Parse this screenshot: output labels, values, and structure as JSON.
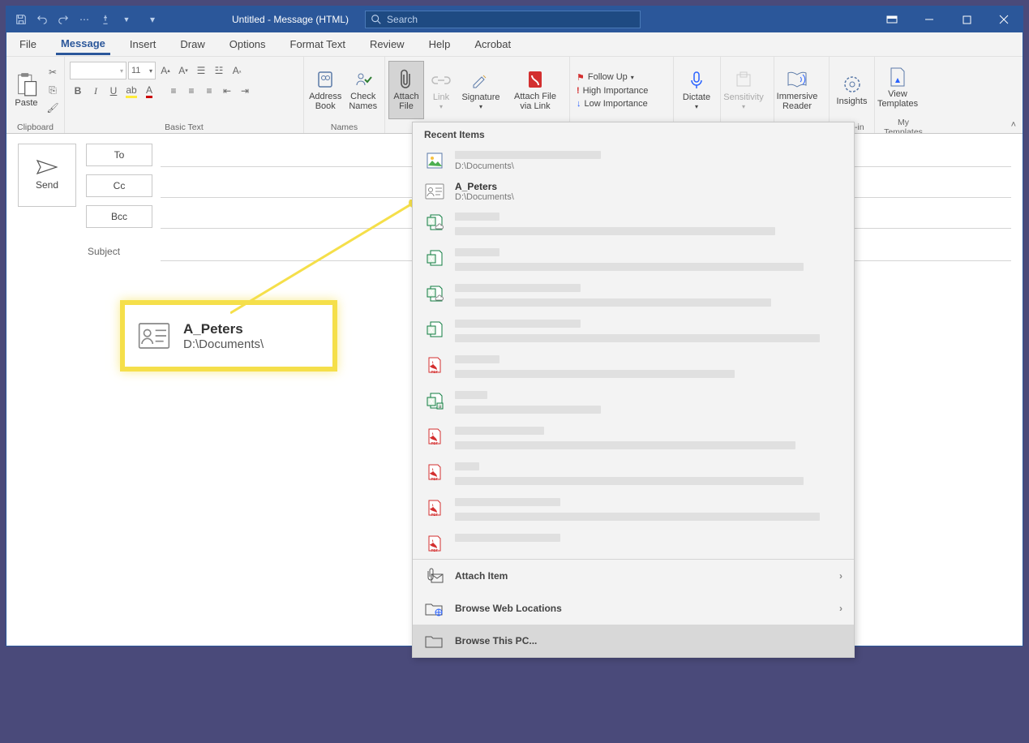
{
  "title": "Untitled  -  Message (HTML)",
  "search": {
    "placeholder": "Search"
  },
  "tabs": [
    "File",
    "Message",
    "Insert",
    "Draw",
    "Options",
    "Format Text",
    "Review",
    "Help",
    "Acrobat"
  ],
  "activeTab": "Message",
  "ribbon": {
    "clipboard": {
      "paste": "Paste",
      "label": "Clipboard"
    },
    "basictext": {
      "label": "Basic Text",
      "fontsize": "11"
    },
    "names": {
      "address": "Address\nBook",
      "check": "Check\nNames",
      "label": "Names"
    },
    "include": {
      "attach": "Attach\nFile",
      "link": "Link",
      "sig": "Signature",
      "via": "Attach File\nvia Link"
    },
    "tags": {
      "follow": "Follow Up",
      "high": "High Importance",
      "low": "Low Importance"
    },
    "dictate": "Dictate",
    "sensitivity": "Sensitivity",
    "immersive": "Immersive\nReader",
    "insights": "Insights",
    "view": "View\nTemplates",
    "addin": "Add-in",
    "mytpl": "My Templates"
  },
  "compose": {
    "send": "Send",
    "to": "To",
    "cc": "Cc",
    "bcc": "Bcc",
    "subject": "Subject"
  },
  "dropdown": {
    "header": "Recent Items",
    "items": [
      {
        "type": "image",
        "name": "",
        "path": "D:\\Documents\\",
        "redactName": true,
        "nameW": 180
      },
      {
        "type": "vcard",
        "name": "A_Peters",
        "path": "D:\\Documents\\"
      },
      {
        "type": "excel-cloud",
        "redactName": true,
        "nameW": 55,
        "pathW": 395
      },
      {
        "type": "excel",
        "redactName": true,
        "nameW": 55,
        "pathW": 430
      },
      {
        "type": "excel-cloud",
        "redactName": true,
        "nameW": 155,
        "pathW": 390
      },
      {
        "type": "excel",
        "redactName": true,
        "nameW": 155,
        "pathW": 450
      },
      {
        "type": "pdf",
        "redactName": true,
        "nameW": 55,
        "pathW": 345
      },
      {
        "type": "excel-a",
        "redactName": true,
        "nameW": 40,
        "pathW": 180
      },
      {
        "type": "pdf",
        "redactName": true,
        "nameW": 110,
        "pathW": 420
      },
      {
        "type": "pdf",
        "redactName": true,
        "nameW": 30,
        "pathW": 430
      },
      {
        "type": "pdf",
        "redactName": true,
        "nameW": 130,
        "pathW": 450
      },
      {
        "type": "pdf",
        "redactName": true,
        "nameW": 130,
        "pathW": 0
      }
    ],
    "footer": [
      {
        "label": "Attach Item",
        "icon": "attach-item",
        "chev": true
      },
      {
        "label": "Browse Web Locations",
        "icon": "web",
        "chev": true
      },
      {
        "label": "Browse This PC...",
        "icon": "pc",
        "hover": true
      }
    ]
  },
  "callout": {
    "name": "A_Peters",
    "path": "D:\\Documents\\"
  }
}
